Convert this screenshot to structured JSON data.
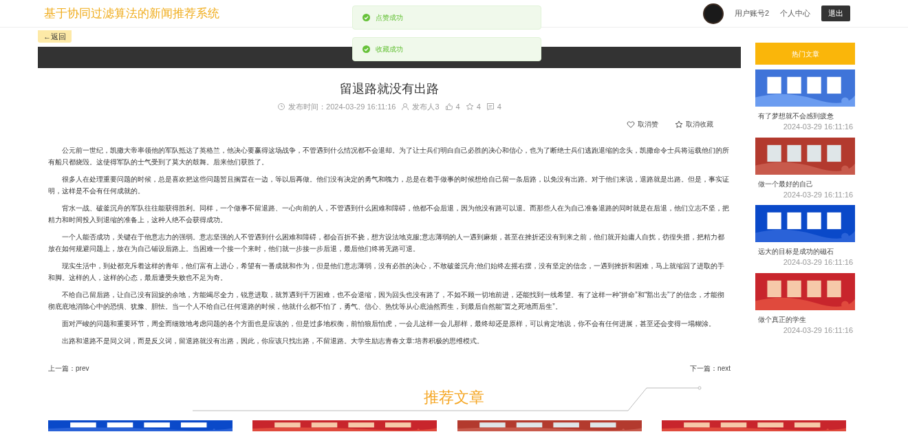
{
  "header": {
    "title": "基于协同过滤算法的新闻推荐系统",
    "user_name": "用户账号2",
    "links": [
      "个人中心"
    ],
    "logout": "退出"
  },
  "toasts": [
    {
      "text": "点赞成功"
    },
    {
      "text": "收藏成功"
    }
  ],
  "back_button": "←返回",
  "article": {
    "title": "留退路就没有出路",
    "meta": [
      {
        "kind": "time",
        "text": "发布时间：2024-03-29 16:11:16"
      },
      {
        "kind": "author",
        "text": "发布人3"
      },
      {
        "kind": "likes",
        "text": "4"
      },
      {
        "kind": "favorites",
        "text": "4"
      },
      {
        "kind": "comments",
        "text": "4"
      }
    ],
    "actions": [
      {
        "kind": "heart",
        "label": "取消赞"
      },
      {
        "kind": "star",
        "label": "取消收藏"
      }
    ],
    "paragraphs": [
      "公元前一世纪，凯撒大帝率领他的军队抵达了英格兰，他决心要赢得这场战争，不管遇到什么情况都不会退却。为了让士兵们明白自己必胜的决心和信心，也为了断绝士兵们逃跑退缩的念头，凯撒命令士兵将运载他们的所有船只都烧毁。这使得军队的士气受到了莫大的鼓舞。后来他们获胜了。",
      "很多人在处理重要问题的时候，总是喜欢把这些问题暂且搁置在一边，等以后再做。他们没有决定的勇气和魄力，总是在着手做事的时候想给自己留一条后路，以免没有出路。对于他们来说，退路就是出路。但是，事实证明，这样是不会有任何成就的。",
      "背水一战、破釜沉舟的军队往往能获得胜利。同样，一个做事不留退路、一心向前的人，不管遇到什么困难和障碍，他都不会后退，因为他没有路可以退。而那些人在为自己准备退路的同时就是在后退，他们立志不坚，把精力和时间投入到退缩的准备上，这种人绝不会获得成功。",
      "一个人能否成功，关键在于他意志力的强弱。意志坚强的人不管遇到什么困难和障碍，都会百折不挠，想方设法地克服;意志薄弱的人一遇到麻烦，甚至在挫折还没有到来之前，他们就开始庸人自扰，彷徨失措，把精力都放在如何规避问题上，放在为自己铺设后路上。当困难一个接一个来时，他们就一步接一步后退，最后他们终将无路可退。",
      "现实生活中，到处都充斥着这样的青年，他们富有上进心，希望有一番成就和作为，但是他们意志薄弱，没有必胜的决心，不敢破釜沉舟;他们始终左摇右摆，没有坚定的信念，一遇到挫折和困难，马上就缩回了进取的手和脚。这样的人，这样的心态，最后遭受失败也不足为奇。",
      "不给自己留后路，让自己没有回旋的余地，方能竭尽全力，锐意进取，就算遇到千万困难，也不会退缩，因为回头也没有路了，不如不顾一切地前进，还能找到一线希望。有了这样一种“拼命”和“豁出去”了的信念，才能彻彻底底地消除心中的恐惧、犹豫、胆怯。当一个人不给自己任何退路的时候，他就什么都不怕了，勇气、信心、热忱等从心底油然而生，到最后自然能“置之死地而后生”。",
      "面对严峻的问题和重要环节，周全而细致地考虑问题的各个方面也是应该的，但是过多地权衡，前怕狼后怕虎，一会儿这样一会儿那样，最终却还是原样，可以肯定地说，你不会有任何进展，甚至还会变得一塌糊涂。",
      "出路和退路不是同义词，而是反义词，留退路就没有出路，因此，你应该只找出路，不留退路。大学生励志青春文章:培养积极的思维模式。"
    ]
  },
  "pager": {
    "prev": "上一篇：prev",
    "next": "下一篇：next"
  },
  "sidebar": {
    "heading": "热门文章",
    "items": [
      {
        "title": "有了梦想就不会感到疲惫",
        "date": "2024-03-29 16:11:16"
      },
      {
        "title": "做一个最好的自己",
        "date": "2024-03-29 16:11:16"
      },
      {
        "title": "远大的目标是成功的磁石",
        "date": "2024-03-29 16:11:16"
      },
      {
        "title": "做个真正的学生",
        "date": "2024-03-29 16:11:16"
      }
    ]
  },
  "recommended": {
    "heading": "推荐文章"
  }
}
